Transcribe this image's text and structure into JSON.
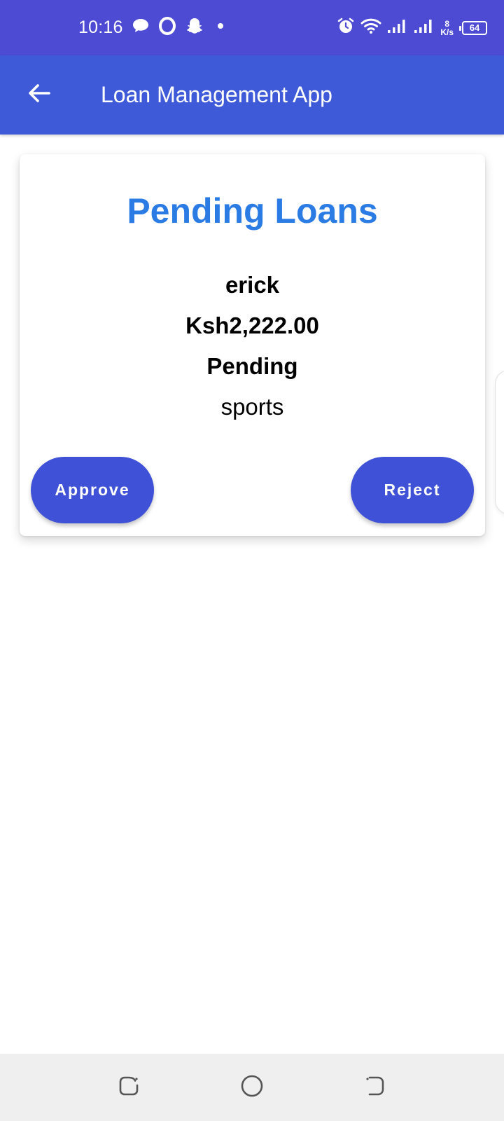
{
  "status_bar": {
    "time": "10:16",
    "net_speed_value": "8",
    "net_speed_unit": "K/s",
    "battery": "64",
    "background": "#4d4ad4",
    "icons": [
      "message-bubble-icon",
      "opera-icon",
      "snapchat-icon",
      "dot-icon",
      "alarm-icon",
      "wifi-icon",
      "signal-icon",
      "signal-icon",
      "battery-icon"
    ]
  },
  "app_bar": {
    "title": "Loan Management App",
    "back_icon": "arrow-left-icon",
    "background": "#3f5ad9"
  },
  "loan_card": {
    "heading": "Pending Loans",
    "borrower": "erick",
    "amount": "Ksh2,222.00",
    "status": "Pending",
    "category": "sports",
    "approve_label": "Approve",
    "reject_label": "Reject",
    "heading_color": "#2a7be4",
    "button_color": "#3f51d6"
  },
  "nav_bar": {
    "icons": [
      "recent-apps-icon",
      "home-icon",
      "back-icon"
    ]
  }
}
